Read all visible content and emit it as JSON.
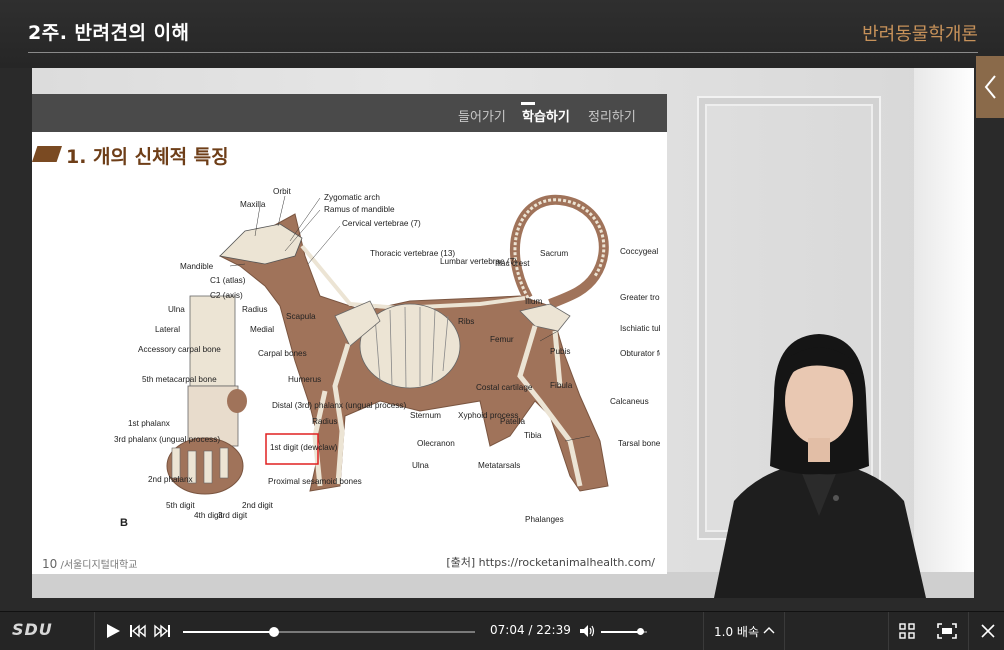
{
  "header": {
    "lesson_title": "2주.  반려견의 이해",
    "course_title": "반려동물학개론"
  },
  "slide": {
    "tabs": [
      {
        "label": "들어가기",
        "active": false
      },
      {
        "label": "학습하기",
        "active": true
      },
      {
        "label": "정리하기",
        "active": false
      }
    ],
    "section_title": "1. 개의 신체적 특징",
    "page_number": "10",
    "institution": "/서울디지털대학교",
    "source": "[출처] https://rocketanimalhealth.com/"
  },
  "figure": {
    "panel_letter": "B",
    "skull_labels": [
      "Orbit",
      "Maxilla",
      "Zygomatic arch",
      "Ramus of mandible",
      "Cervical vertebrae (7)",
      "Mandible",
      "C1 (atlas)",
      "C2 (axis)"
    ],
    "spine_labels": [
      "Thoracic vertebrae (13)",
      "Lumbar vertebrae (7)",
      "Iliac crest",
      "Sacrum",
      "Coccygeal vertebrae",
      "Ilium"
    ],
    "body_labels": [
      "Scapula",
      "Ribs",
      "Femur",
      "Greater trochanter of femur",
      "Ischiatic tuberosity",
      "Obturator foramen",
      "Pubis",
      "Humerus",
      "Costal cartilage",
      "Xyphoid process",
      "Sternum",
      "Radius",
      "Olecranon",
      "Patella",
      "Tibia",
      "Fibula",
      "Calcaneus",
      "Tarsal bones",
      "Metatarsals",
      "Ulna",
      "Phalanges"
    ],
    "paw_labels": [
      "Ulna",
      "Radius",
      "Lateral",
      "Medial",
      "Accessory carpal bone",
      "Carpal bones",
      "5th metacarpal bone",
      "Distal (3rd) phalanx (ungual process)",
      "1st phalanx",
      "3rd phalanx (ungual process)",
      "1st digit (dewclaw)",
      "2nd phalanx",
      "Proximal sesamoid bones",
      "5th digit",
      "4th digit",
      "3rd digit",
      "2nd digit"
    ],
    "highlight_color": "#e02020",
    "body_color": "#a0735a",
    "bone_color": "#ece4d4"
  },
  "player": {
    "logo": "SDU",
    "current_time": "07:04",
    "total_time": "22:39",
    "time_display": "07:04 / 22:39",
    "progress_fraction": 0.312,
    "volume_fraction": 0.85,
    "speed_label": "1.0 배속"
  }
}
